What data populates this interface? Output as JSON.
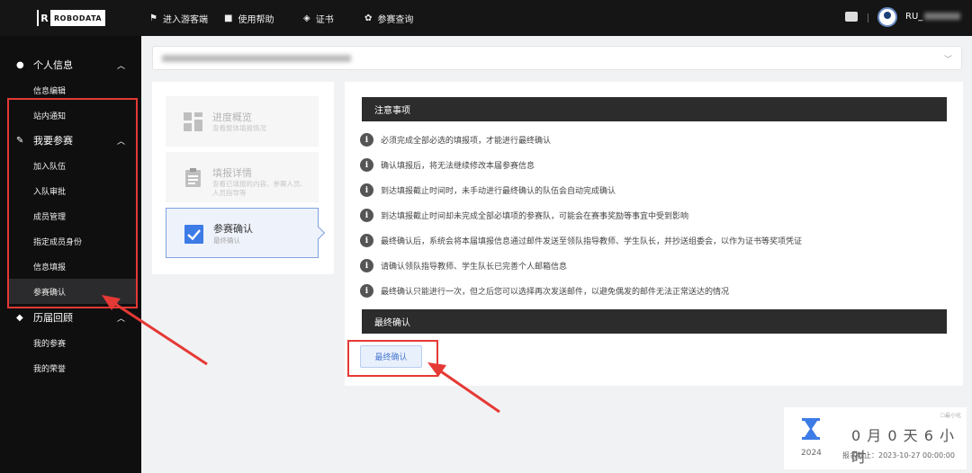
{
  "header": {
    "logo_mark": "R",
    "logo_text": "ROBODATA",
    "nav": [
      {
        "icon": "flag-icon",
        "label": "进入游客端"
      },
      {
        "icon": "book-icon",
        "label": "使用帮助"
      },
      {
        "icon": "diamond-icon",
        "label": "证书"
      },
      {
        "icon": "gear-icon",
        "label": "参赛查询"
      }
    ],
    "username": "RU_"
  },
  "sidebar": {
    "groups": [
      {
        "icon": "user-icon",
        "label": "个人信息",
        "items": [
          "信息编辑",
          "站内通知"
        ]
      },
      {
        "icon": "edit-icon",
        "label": "我要参赛",
        "items": [
          "加入队伍",
          "入队审批",
          "成员管理",
          "指定成员身份",
          "信息填报",
          "参赛确认"
        ]
      },
      {
        "icon": "cube-icon",
        "label": "历届回顾",
        "items": [
          "我的参赛",
          "我的荣誉"
        ]
      }
    ],
    "active_item": "参赛确认"
  },
  "steps": [
    {
      "title": "进度概览",
      "desc": "查看整体填报情况",
      "icon": "grid-icon"
    },
    {
      "title": "填报详情",
      "desc": "查看已填报的内容，参赛人员、人员指导等",
      "icon": "clipboard-icon"
    },
    {
      "title": "参赛确认",
      "desc": "最终确认",
      "icon": "checkbox-icon"
    }
  ],
  "notice": {
    "title": "注意事项",
    "items": [
      "必须完成全部必选的填报项，才能进行最终确认",
      "确认填报后，将无法继续修改本届参赛信息",
      "到达填报截止时间时，未手动进行最终确认的队伍会自动完成确认",
      "到达填报截止时间却未完成全部必填项的参赛队，可能会在赛事奖励等事宜中受到影响",
      "最终确认后，系统会将本届填报信息通过邮件发送至领队指导教师、学生队长，并抄送组委会，以作为证书等奖项凭证",
      "请确认领队指导教师、学生队长已完善个人邮箱信息",
      "最终确认只能进行一次，但之后您可以选择再次发送邮件，以避免偶发的邮件无法正常送达的情况"
    ]
  },
  "final": {
    "title": "最终确认",
    "button": "最终确认"
  },
  "countdown": {
    "corner": "☐最小化",
    "year": "2024",
    "time": "0 月 0 天 6 小时",
    "deadline": "报名截止：2023-10-27 00:00:00"
  },
  "colors": {
    "topbar": "#151515",
    "sidebar": "#0f0f10",
    "accent": "#4a7ad0",
    "annotation": "#e53935"
  }
}
